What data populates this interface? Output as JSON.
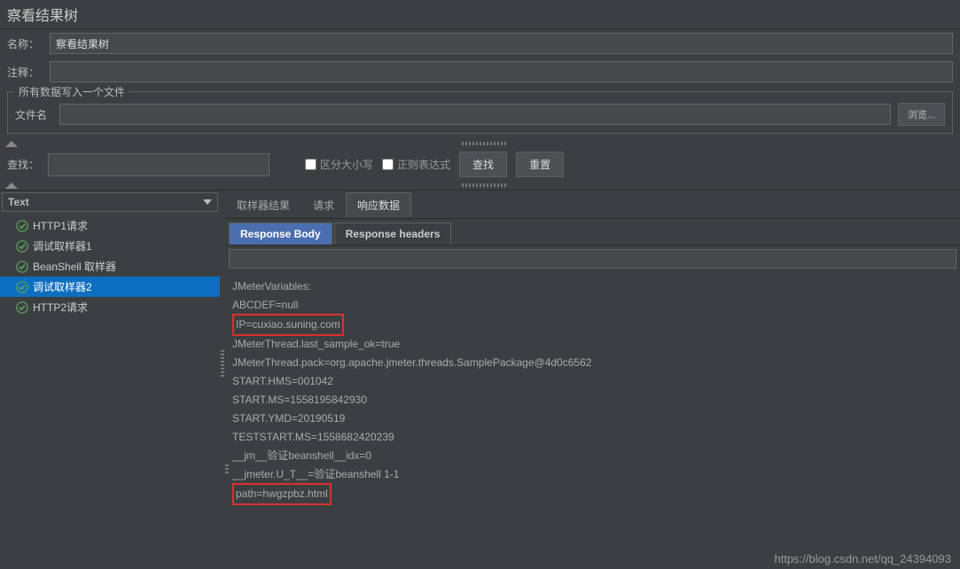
{
  "title": "察看结果树",
  "fields": {
    "name_label": "名称：",
    "name_value": "察看结果树",
    "comment_label": "注释：",
    "comment_value": ""
  },
  "fileSection": {
    "legend": "所有数据写入一个文件",
    "filename_label": "文件名",
    "filename_value": "",
    "browse_label": "浏览..."
  },
  "search": {
    "label": "查找：",
    "value": "",
    "case_label": "区分大小写",
    "regex_label": "正则表达式",
    "find_btn": "查找",
    "reset_btn": "重置"
  },
  "leftPanel": {
    "dropdown": "Text",
    "items": [
      {
        "label": "HTTP1请求",
        "selected": false
      },
      {
        "label": "调试取样器1",
        "selected": false
      },
      {
        "label": "BeanShell 取样器",
        "selected": false
      },
      {
        "label": "调试取样器2",
        "selected": true
      },
      {
        "label": "HTTP2请求",
        "selected": false
      }
    ]
  },
  "tabs": {
    "items": [
      "取样器结果",
      "请求",
      "响应数据"
    ],
    "active_index": 2
  },
  "subTabs": {
    "items": [
      "Response Body",
      "Response headers"
    ],
    "active_index": 0
  },
  "responseData": {
    "lines": [
      {
        "text": "JMeterVariables:",
        "highlight": false
      },
      {
        "text": "ABCDEF=null",
        "highlight": false
      },
      {
        "text": "IP=cuxiao.suning.com",
        "highlight": true
      },
      {
        "text": "JMeterThread.last_sample_ok=true",
        "highlight": false
      },
      {
        "text": "JMeterThread.pack=org.apache.jmeter.threads.SamplePackage@4d0c6562",
        "highlight": false
      },
      {
        "text": "START.HMS=001042",
        "highlight": false
      },
      {
        "text": "START.MS=1558195842930",
        "highlight": false
      },
      {
        "text": "START.YMD=20190519",
        "highlight": false
      },
      {
        "text": "TESTSTART.MS=1558682420239",
        "highlight": false
      },
      {
        "text": "__jm__验证beanshell__idx=0",
        "highlight": false
      },
      {
        "text": "__jmeter.U_T__=验证beanshell 1-1",
        "highlight": false
      },
      {
        "text": "path=hwgzpbz.html",
        "highlight": true
      }
    ]
  },
  "watermark": "https://blog.csdn.net/qq_24394093"
}
